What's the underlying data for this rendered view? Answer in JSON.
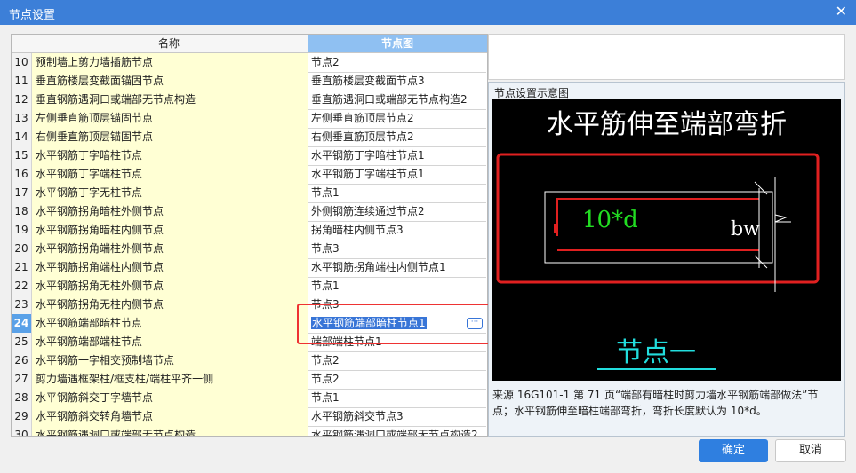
{
  "window": {
    "title": "节点设置",
    "close_glyph": "✕"
  },
  "table": {
    "headers": {
      "name": "名称",
      "node": "节点图"
    },
    "rows": [
      {
        "num": "10",
        "name": "预制墙上剪力墙插筋节点",
        "node": "节点2"
      },
      {
        "num": "11",
        "name": "垂直筋楼层变截面锚固节点",
        "node": "垂直筋楼层变截面节点3"
      },
      {
        "num": "12",
        "name": "垂直钢筋遇洞口或端部无节点构造",
        "node": "垂直筋遇洞口或端部无节点构造2"
      },
      {
        "num": "13",
        "name": "左侧垂直筋顶层锚固节点",
        "node": "左侧垂直筋顶层节点2"
      },
      {
        "num": "14",
        "name": "右侧垂直筋顶层锚固节点",
        "node": "右侧垂直筋顶层节点2"
      },
      {
        "num": "15",
        "name": "水平钢筋丁字暗柱节点",
        "node": "水平钢筋丁字暗柱节点1"
      },
      {
        "num": "16",
        "name": "水平钢筋丁字端柱节点",
        "node": "水平钢筋丁字端柱节点1"
      },
      {
        "num": "17",
        "name": "水平钢筋丁字无柱节点",
        "node": "节点1"
      },
      {
        "num": "18",
        "name": "水平钢筋拐角暗柱外侧节点",
        "node": "外侧钢筋连续通过节点2"
      },
      {
        "num": "19",
        "name": "水平钢筋拐角暗柱内侧节点",
        "node": "拐角暗柱内侧节点3"
      },
      {
        "num": "20",
        "name": "水平钢筋拐角端柱外侧节点",
        "node": "节点3"
      },
      {
        "num": "21",
        "name": "水平钢筋拐角端柱内侧节点",
        "node": "水平钢筋拐角端柱内侧节点1"
      },
      {
        "num": "22",
        "name": "水平钢筋拐角无柱外侧节点",
        "node": "节点1"
      },
      {
        "num": "23",
        "name": "水平钢筋拐角无柱内侧节点",
        "node": "节点3"
      },
      {
        "num": "24",
        "name": "水平钢筋端部暗柱节点",
        "node": "水平钢筋端部暗柱节点1"
      },
      {
        "num": "25",
        "name": "水平钢筋端部端柱节点",
        "node": "端部端柱节点1"
      },
      {
        "num": "26",
        "name": "水平钢筋一字相交预制墙节点",
        "node": "节点2"
      },
      {
        "num": "27",
        "name": "剪力墙遇框架柱/框支柱/端柱平齐一侧",
        "node": "节点2"
      },
      {
        "num": "28",
        "name": "水平钢筋斜交丁字墙节点",
        "node": "节点1"
      },
      {
        "num": "29",
        "name": "水平钢筋斜交转角墙节点",
        "node": "水平钢筋斜交节点3"
      },
      {
        "num": "30",
        "name": "水平钢筋遇洞口或端部无节点构造",
        "node": "水平钢筋遇洞口或端部无节点构造2"
      }
    ],
    "selected_row": "24",
    "ellipsis_glyph": "···"
  },
  "preview": {
    "panel_title": "节点设置示意图",
    "diagram_title": "水平筋伸至端部弯折",
    "label_10d": "10*d",
    "label_bw": "bw",
    "caption": "节点一",
    "description_line1": "来源 16G101-1 第 71 页“端部有暗柱时剪力墙水平钢筋端部做法”节",
    "description_line2": "点；水平钢筋伸至暗柱端部弯折，弯折长度默认为 10*d。",
    "colors": {
      "title": "#ffffff",
      "green": "#22dd22",
      "red": "#e02020",
      "cyan": "#22dddd",
      "line": "#ffffff"
    }
  },
  "buttons": {
    "ok": "确定",
    "cancel": "取消"
  }
}
